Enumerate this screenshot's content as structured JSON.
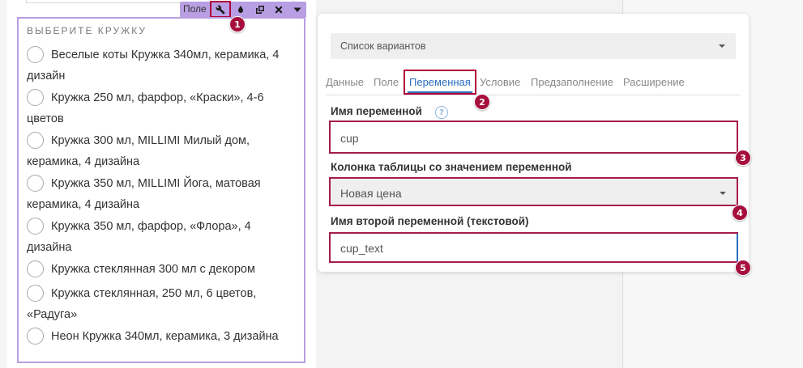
{
  "form_field": {
    "title": "ВЫБЕРИТЕ КРУЖКУ",
    "options": [
      "Веселые коты Кружка 340мл, керамика, 4 дизайн",
      "Кружка 250 мл, фарфор, «Краски», 4-6 цветов",
      "Кружка 300 мл, MILLIMI Милый дом, керамика, 4 дизайна",
      "Кружка 350 мл, MILLIMI Йога, матовая керамика, 4 дизайна",
      "Кружка 350 мл, фарфор, «Флора», 4 дизайна",
      "Кружка стеклянная 300 мл с декором",
      "Кружка стеклянная, 250 мл, 6 цветов, «Радуга»",
      "Неон Кружка 340мл, керамика, 3 дизайна"
    ]
  },
  "toolbar": {
    "label": "Поле",
    "icons": [
      "wrench-icon",
      "drop-icon",
      "copy-icon",
      "close-icon",
      "caret-down-icon"
    ]
  },
  "markers": [
    "1",
    "2",
    "3",
    "4",
    "5"
  ],
  "settings": {
    "field_type": "Список вариантов",
    "tabs": [
      "Данные",
      "Поле",
      "Переменная",
      "Условие",
      "Предзаполнение",
      "Расширение"
    ],
    "active_tab": "Переменная",
    "variable_name_label": "Имя переменной",
    "help_icon": "?",
    "variable_name_value": "cup",
    "column_label": "Колонка таблицы со значением переменной",
    "column_value": "Новая цена",
    "second_variable_label": "Имя второй переменной (текстовой)",
    "second_variable_value": "cup_text"
  },
  "colors": {
    "widget_border": "#b99ee0",
    "toolbar_bg": "#b89fe3",
    "highlight": "#a50e3d",
    "active_tab": "#2a6ebd"
  }
}
